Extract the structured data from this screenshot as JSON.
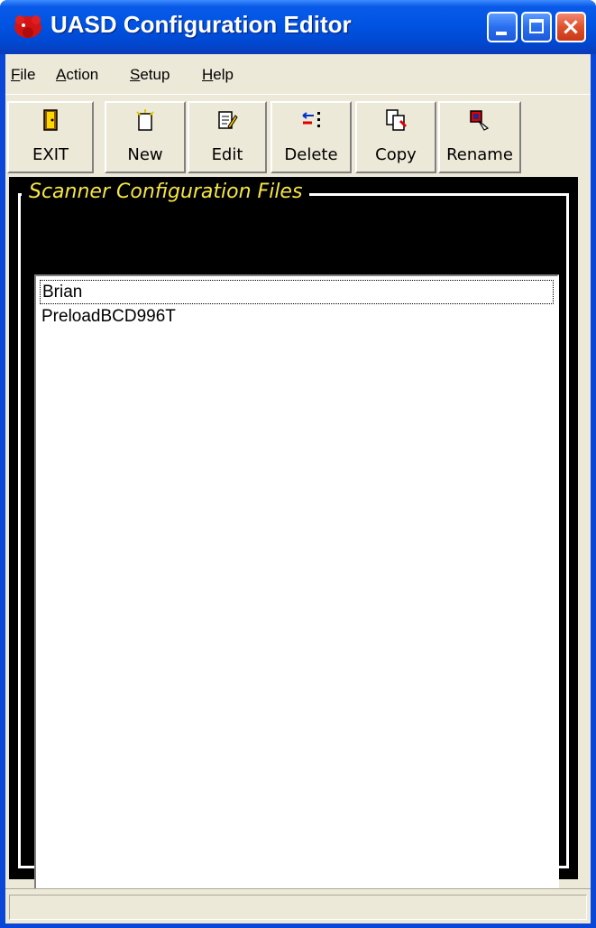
{
  "window": {
    "title": "UASD Configuration Editor",
    "controls": {
      "minimize": "minimize",
      "maximize": "maximize",
      "close": "×"
    }
  },
  "menu": {
    "items": [
      {
        "label_u": "F",
        "label_rest": "ile"
      },
      {
        "label_u": "A",
        "label_rest": "ction"
      },
      {
        "label_u": "S",
        "label_rest": "etup"
      },
      {
        "label_u": "H",
        "label_rest": "elp"
      }
    ]
  },
  "toolbar": {
    "buttons": [
      {
        "label": "EXIT",
        "icon": "door-exit-icon"
      },
      {
        "label": "New",
        "icon": "new-document-icon"
      },
      {
        "label": "Edit",
        "icon": "edit-document-icon"
      },
      {
        "label": "Delete",
        "icon": "delete-arrows-icon"
      },
      {
        "label": "Copy",
        "icon": "copy-document-icon"
      },
      {
        "label": "Rename",
        "icon": "rename-icon"
      }
    ]
  },
  "group": {
    "title": "Scanner Configuration Files"
  },
  "files": {
    "items": [
      "Brian",
      "PreloadBCD996T"
    ],
    "focused_index": 0
  },
  "status": {
    "text": ""
  },
  "colors": {
    "titlebar": "#0054e3",
    "client_bg": "#ece9d8",
    "group_bg": "#000000",
    "group_title": "#f5e642"
  }
}
